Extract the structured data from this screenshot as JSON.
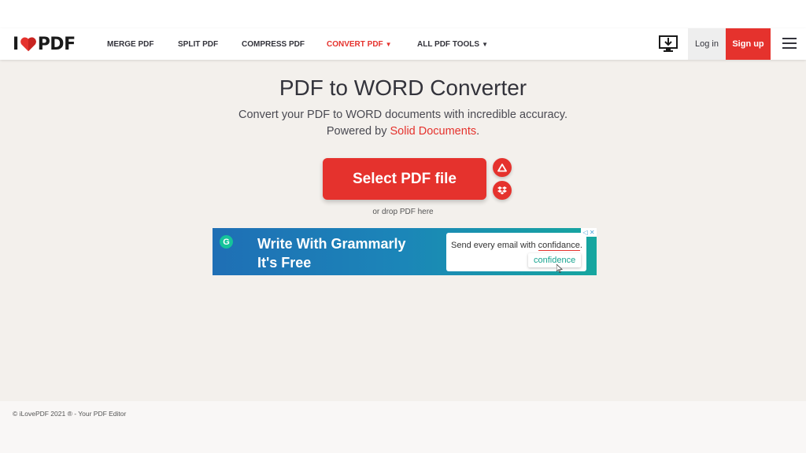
{
  "header": {
    "logo": {
      "left": "I",
      "right": "PDF",
      "heart_color": "#e5322d"
    },
    "nav": [
      {
        "label": "MERGE PDF"
      },
      {
        "label": "SPLIT PDF"
      },
      {
        "label": "COMPRESS PDF"
      },
      {
        "label": "CONVERT PDF",
        "active": true
      },
      {
        "label": "ALL PDF TOOLS"
      }
    ],
    "login_label": "Log in",
    "signup_label": "Sign up",
    "icons": [
      "download-desktop-icon",
      "hamburger-menu-icon"
    ]
  },
  "main": {
    "title": "PDF to WORD Converter",
    "subtitle_line1": "Convert your PDF to WORD documents with incredible accuracy.",
    "subtitle_line2_prefix": "Powered by ",
    "subtitle_link": "Solid Documents",
    "subtitle_line2_suffix": ".",
    "select_button": "Select PDF file",
    "drop_text": "or drop PDF here",
    "cloud_icons": [
      "google-drive-icon",
      "dropbox-icon"
    ]
  },
  "ad": {
    "badge": "G",
    "headline_line1": "Write With Grammarly",
    "headline_line2": "It's Free",
    "card_text_prefix": "Send every email with ",
    "card_misspelled": "confidance",
    "card_text_suffix": ".",
    "suggestion": "confidence",
    "close_label": "◁ ✕"
  },
  "footer": {
    "text": "© iLovePDF 2021 ® - Your PDF Editor"
  },
  "colors": {
    "brand": "#e5322d",
    "main_bg": "#f3f0ec",
    "text": "#33333b"
  }
}
